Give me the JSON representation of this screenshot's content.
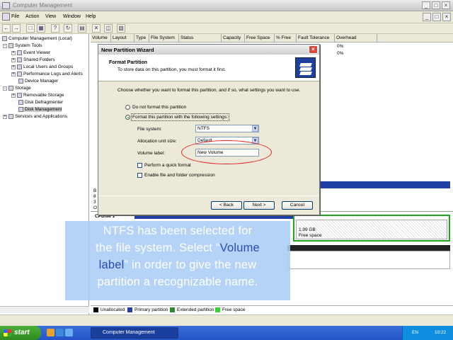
{
  "window": {
    "title": "Computer Management",
    "controls": [
      "_",
      "□",
      "×"
    ]
  },
  "menubar": {
    "items": [
      "File",
      "Action",
      "View",
      "Window",
      "Help"
    ],
    "doc_controls": [
      "_",
      "□",
      "×"
    ]
  },
  "toolbar": {
    "icons": [
      "back-icon",
      "forward-icon",
      "up-icon",
      "properties-icon",
      "help-icon",
      "refresh-icon",
      "show-tree-icon",
      "delete-icon",
      "folder-icon",
      "disk-icon"
    ]
  },
  "tree": {
    "items": [
      {
        "label": "Computer Management (Local)",
        "indent": 0
      },
      {
        "label": "System Tools",
        "indent": 1
      },
      {
        "label": "Event Viewer",
        "indent": 2
      },
      {
        "label": "Shared Folders",
        "indent": 2
      },
      {
        "label": "Local Users and Groups",
        "indent": 2
      },
      {
        "label": "Performance Logs and Alerts",
        "indent": 2
      },
      {
        "label": "Device Manager",
        "indent": 2
      },
      {
        "label": "Storage",
        "indent": 1
      },
      {
        "label": "Removable Storage",
        "indent": 2
      },
      {
        "label": "Disk Defragmenter",
        "indent": 2
      },
      {
        "label": "Disk Management",
        "indent": 2
      },
      {
        "label": "Services and Applications",
        "indent": 1
      }
    ]
  },
  "list_header": {
    "columns": [
      "Volume",
      "Layout",
      "Type",
      "File System",
      "Status",
      "Capacity",
      "Free Space",
      "% Free",
      "Fault Tolerance",
      "Overhead"
    ]
  },
  "list_rows": {
    "overhead": [
      "0%",
      "0%"
    ]
  },
  "disk_view": {
    "disk1_label": "CPDisk 1",
    "free_size": "1.99 GB",
    "free_label": "Free space",
    "side_labels": [
      "B",
      "8",
      "3",
      "O"
    ]
  },
  "legend": {
    "items": [
      {
        "label": "Unallocated",
        "color": "#000000"
      },
      {
        "label": "Primary partition",
        "color": "#1f3fa5"
      },
      {
        "label": "Extended partition",
        "color": "#2e8b2e"
      },
      {
        "label": "Free space",
        "color": "#39d239"
      }
    ]
  },
  "dialog": {
    "title": "New Partition Wizard",
    "heading": "Format Partition",
    "subheading": "To store data on this partition, you must format it first.",
    "question": "Choose whether you want to format this partition, and if so, what settings you want to use.",
    "radio_no_format": "Do not format this partition",
    "radio_format": "Format this partition with the following settings:",
    "file_system_label": "File system:",
    "file_system_value": "NTFS",
    "alloc_label": "Allocation unit size:",
    "alloc_value": "Default",
    "volume_label_label": "Volume label:",
    "volume_label_value": "New Volume",
    "quick_format": "Perform a quick format",
    "compression": "Enable file and folder compression",
    "back_button": "< Back",
    "next_button": "Next >",
    "cancel_button": "Cancel"
  },
  "annotation": {
    "line1": "NTFS has been selected for",
    "line2_pre": "the file system. Select “",
    "line2_hl": "Volume",
    "line3_hl": "label",
    "line3_post": "” in order to give the new",
    "line4": "partition a recognizable name."
  },
  "taskbar": {
    "start": "start",
    "task": "Computer Management",
    "lang": "EN",
    "clock": "10:22"
  }
}
